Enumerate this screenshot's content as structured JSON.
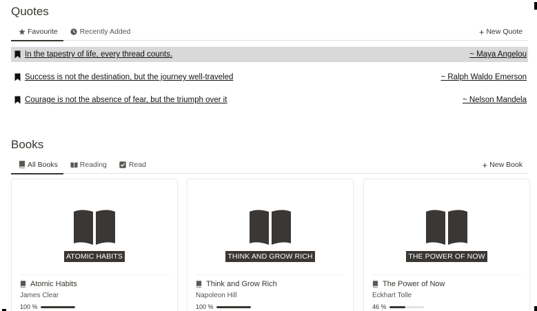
{
  "quotes": {
    "title": "Quotes",
    "tabs": [
      {
        "label": "Favourite",
        "icon": "star-icon"
      },
      {
        "label": "Recently Added",
        "icon": "clock-icon"
      }
    ],
    "new_label": "New Quote",
    "items": [
      {
        "text": "In the tapestry of life, every thread counts.",
        "author": "~ Maya Angelou",
        "highlighted": true
      },
      {
        "text": "Success is not the destination, but the journey well-traveled",
        "author": "~ Ralph Waldo Emerson",
        "highlighted": false
      },
      {
        "text": "Courage is not the absence of fear, but the triumph over it",
        "author": "~ Nelson Mandela",
        "highlighted": false
      }
    ]
  },
  "books": {
    "title": "Books",
    "tabs": [
      {
        "label": "All Books",
        "icon": "book-icon"
      },
      {
        "label": "Reading",
        "icon": "open-book-icon"
      },
      {
        "label": "Read",
        "icon": "checkbox-icon"
      }
    ],
    "new_label": "New Book",
    "items": [
      {
        "cover_label": "ATOMIC HABITS",
        "title": "Atomic Habits",
        "author": "James Clear",
        "progress_text": "100 %",
        "progress": 1.0
      },
      {
        "cover_label": "THINK AND GROW RICH",
        "title": "Think and Grow Rich",
        "author": "Napoleon Hill",
        "progress_text": "100 %",
        "progress": 1.0
      },
      {
        "cover_label": "THE POWER OF NOW",
        "title": "The Power of Now",
        "author": "Eckhart Tolle",
        "progress_text": "46 %",
        "progress": 0.46
      }
    ]
  },
  "colors": {
    "text": "#37352f",
    "highlight_row": "#d9d9d9",
    "cover_label_bg": "#3a3734",
    "progress_track": "#e3e2e0"
  }
}
